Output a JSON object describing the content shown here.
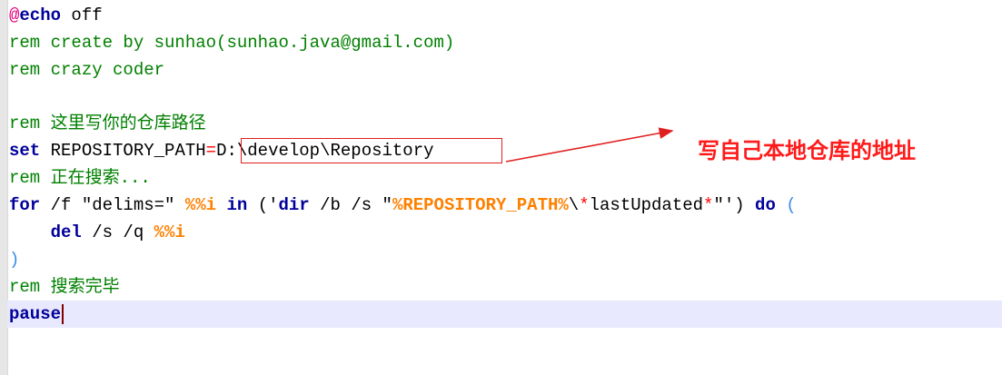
{
  "code": {
    "line1": {
      "at": "@",
      "kw": "echo",
      "rest": " off"
    },
    "line2": {
      "text": "rem create by sunhao(sunhao.java@gmail.com)"
    },
    "line3": {
      "text": "rem crazy coder"
    },
    "line5": {
      "text": "rem 这里写你的仓库路径"
    },
    "line6": {
      "kw": "set",
      "name": " REPOSITORY_PATH",
      "eq": "=",
      "value": "D:\\develop\\Repository"
    },
    "line7": {
      "text": "rem 正在搜索..."
    },
    "line8": {
      "kw_for": "for",
      "opts": " /f \"delims=\" ",
      "var1": "%%i",
      "sp1": " ",
      "kw_in": "in",
      "open": " ('",
      "kw_dir": "dir",
      "args": " /b /s \"",
      "var2": "%REPOSITORY_PATH%",
      "sep": "\\",
      "star1": "*",
      "fname": "lastUpdated",
      "star2": "*",
      "close": "\"') ",
      "kw_do": "do",
      "paren": " ("
    },
    "line9": {
      "indent": "    ",
      "kw": "del",
      "args": " /s /q ",
      "var": "%%i"
    },
    "line10": {
      "paren": ")"
    },
    "line11": {
      "text": "rem 搜索完毕"
    },
    "line12": {
      "kw": "pause"
    }
  },
  "annotation": {
    "text": "写自己本地仓库的地址"
  },
  "colors": {
    "keyword": "#00009a",
    "comment": "#008000",
    "variable": "#ff8000",
    "annotation": "#ff1a1a",
    "current_line": "#e8e8ff"
  }
}
